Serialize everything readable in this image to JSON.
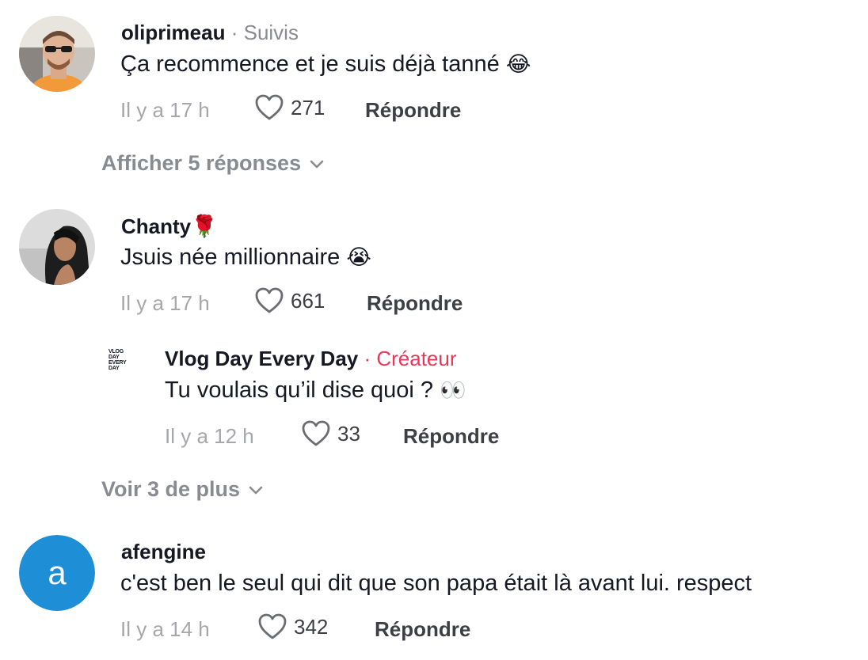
{
  "comments": [
    {
      "username": "oliprimeau",
      "tag": "· Suivis",
      "text": "Ça recommence et je suis déjà tanné",
      "emoji": "😂",
      "time": "Il y a 17 h",
      "likes": "271",
      "reply_label": "Répondre",
      "expand_label": "Afficher 5 réponses"
    },
    {
      "username": "Chanty",
      "username_emoji": "🌹",
      "text": "Jsuis née millionnaire",
      "emoji": "😭",
      "time": "Il y a 17 h",
      "likes": "661",
      "reply_label": "Répondre",
      "reply": {
        "username": "Vlog Day Every Day",
        "tag": "· Créateur",
        "logo_text": [
          "VLOG",
          "DAY",
          "EVERY",
          "DAY"
        ],
        "text": "Tu voulais qu’il dise quoi ?",
        "emoji": "👀",
        "time": "Il y a 12 h",
        "likes": "33",
        "reply_label": "Répondre"
      },
      "expand_label": "Voir 3 de plus"
    },
    {
      "username": "afengine",
      "avatar_letter": "a",
      "text": "c'est ben le seul qui dit que son papa était là avant lui. respect",
      "time": "Il y a 14 h",
      "likes": "342",
      "reply_label": "Répondre"
    }
  ],
  "colors": {
    "creator_tag": "#e8385a",
    "muted": "#8a8b91",
    "letter_avatar": "#1e8fd6"
  }
}
